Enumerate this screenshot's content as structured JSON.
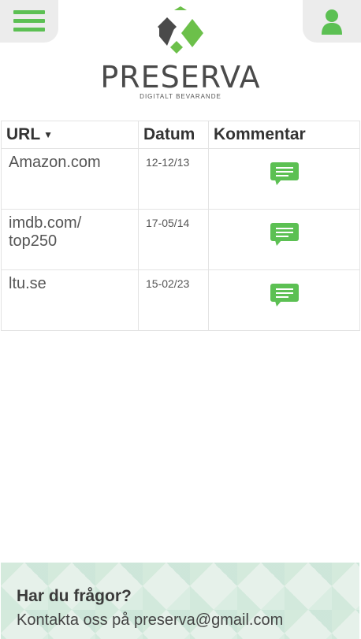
{
  "header": {
    "brand": "PRESERVA",
    "tagline": "DIGITALT BEVARANDE",
    "menu_icon": "hamburger-menu-icon",
    "profile_icon": "user-profile-icon"
  },
  "colors": {
    "accent": "#5cc053",
    "logo_dark": "#4a4a4a",
    "logo_green": "#6cc04a"
  },
  "table": {
    "columns": [
      "URL",
      "Datum",
      "Kommentar"
    ],
    "sort_icon": "caret-down-icon",
    "rows": [
      {
        "url": "Amazon.com",
        "date": "12-12/13",
        "comment_icon": "comment-icon"
      },
      {
        "url": "imdb.com/\ntop250",
        "date": "17-05/14",
        "comment_icon": "comment-icon"
      },
      {
        "url": "ltu.se",
        "date": "15-02/23",
        "comment_icon": "comment-icon"
      }
    ]
  },
  "footer": {
    "title": "Har du frågor?",
    "contact": "Kontakta oss på preserva@gmail.com"
  }
}
